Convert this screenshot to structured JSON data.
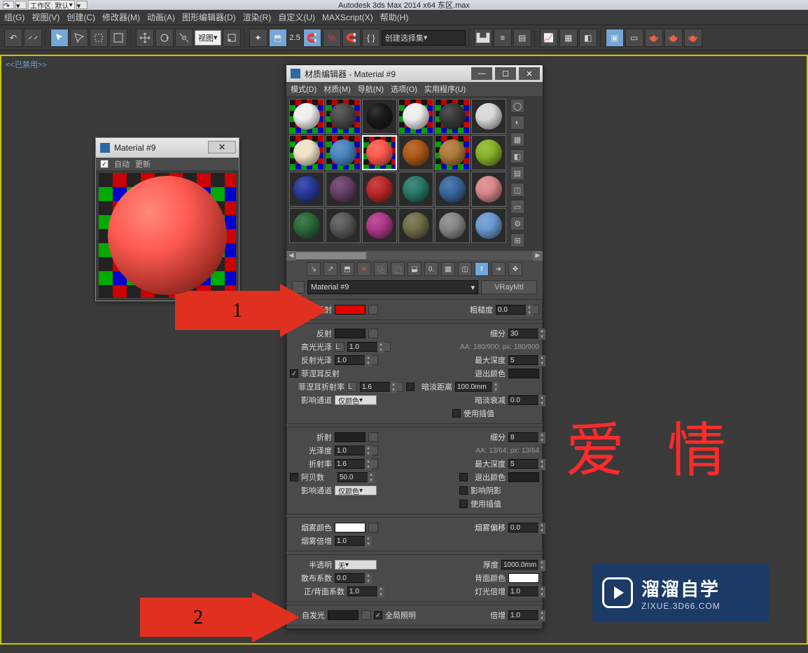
{
  "title": "Autodesk 3ds Max  2014 x64     东区.max",
  "quick": {
    "workspace": "工作区: 默认"
  },
  "menu": [
    "组(G)",
    "视图(V)",
    "创建(C)",
    "修改器(M)",
    "动画(A)",
    "图形编辑器(D)",
    "渲染(R)",
    "自定义(U)",
    "MAXScript(X)",
    "帮助(H)"
  ],
  "toolbar": {
    "combo1": "视图",
    "zoom": "2.5",
    "setSelect": "创建选择集"
  },
  "viewportLabel": "<<已禁用>>",
  "matprev": {
    "title": "Material #9",
    "auto": "自动",
    "update": "更新",
    "autoChecked": "✓"
  },
  "editor": {
    "title": "材质编辑器 - Material #9",
    "menu": [
      "模式(D)",
      "材质(M)",
      "导航(N)",
      "选项(O)",
      "实用程序(U)"
    ],
    "name": "Material #9",
    "type": "VRayMtl"
  },
  "diffuse": {
    "label": "漫反射",
    "roughLabel": "粗糙度",
    "rough": "0.0"
  },
  "reflect": {
    "label": "反射",
    "subdivLabel": "细分",
    "subdiv": "30",
    "hgLabel": "高光光泽",
    "hgL": "L",
    "hg": "1.0",
    "aa": "AA: 180/900; px: 180/900",
    "rgLabel": "反射光泽",
    "rg": "1.0",
    "depthLabel": "最大深度",
    "depth": "5",
    "fresnelLabel": "菲涅耳反射",
    "fresnelChecked": "✓",
    "fiorLabel": "菲涅耳折射率",
    "fiorL": "L",
    "fior": "1.6",
    "exitLabel": "退出颜色",
    "dimDistLabel": "暗淡距离",
    "dimDist": "100.0mm",
    "chanLabel": "影响通道",
    "chan": "仅颜色",
    "dimFallLabel": "暗淡衰减",
    "dimFall": "0.0",
    "interpLabel": "使用插值"
  },
  "refract": {
    "label": "折射",
    "subdivLabel": "细分",
    "subdiv": "8",
    "glossLabel": "光泽度",
    "gloss": "1.0",
    "aa": "AA: 13/64; px: 13/64",
    "iorLabel": "折射率",
    "ior": "1.6",
    "depthLabel": "最大深度",
    "depth": "5",
    "abbeLabel": "阿贝数",
    "abbe": "50.0",
    "exitLabel": "退出颜色",
    "chanLabel": "影响通道",
    "chan": "仅颜色",
    "shadowLabel": "影响阴影",
    "interpLabel": "使用插值"
  },
  "fog": {
    "colorLabel": "烟雾颜色",
    "biasLabel": "烟雾偏移",
    "bias": "0.0",
    "multLabel": "烟雾倍增",
    "mult": "1.0"
  },
  "trans": {
    "label": "半透明",
    "mode": "无",
    "thickLabel": "厚度",
    "thick": "1000.0mm",
    "scatterLabel": "散布系数",
    "scatter": "0.0",
    "backLabel": "背面颜色",
    "fbLabel": "正/背面系数",
    "fb": "1.0",
    "lightMultLabel": "灯光倍增",
    "lightMult": "1.0"
  },
  "selfillum": {
    "label": "自发光",
    "giLabel": "全局照明",
    "giChecked": "✓",
    "multLabel": "倍增",
    "mult": "1.0"
  },
  "ann": {
    "n1": "1",
    "n2": "2"
  },
  "love": "爱  情",
  "logo": {
    "t1": "溜溜自学",
    "t2": "ZIXUE.3D66.COM"
  },
  "swatches": {
    "colors": [
      {
        "c": "#eeeeee",
        "chk": true
      },
      {
        "c": "#4a4a4a",
        "chk": true
      },
      {
        "c": "#1a1a1a"
      },
      {
        "c": "#eeeeee",
        "chk": true
      },
      {
        "c": "#3a3a3a",
        "chk": true
      },
      {
        "c": "#d8d8d8"
      },
      {
        "c": "#efe4c6",
        "chk": true
      },
      {
        "c": "#4a86c0",
        "chk": true
      },
      {
        "c": "#ff5a50",
        "chk": true,
        "sel": true
      },
      {
        "c": "#b05a1a"
      },
      {
        "c": "#b07a3a",
        "chk": true
      },
      {
        "c": "#8ab42a"
      },
      {
        "c": "#2c3aa0"
      },
      {
        "c": "#6a406a"
      },
      {
        "c": "#c02a2a"
      },
      {
        "c": "#2a7a6a"
      },
      {
        "c": "#3a6aa0"
      },
      {
        "c": "#d88a8a"
      },
      {
        "c": "#2a6a3a"
      },
      {
        "c": "#5a5a5a"
      },
      {
        "c": "#b03a8a"
      },
      {
        "c": "#70704a"
      },
      {
        "c": "#888888"
      },
      {
        "c": "#6a9ad0"
      }
    ]
  }
}
